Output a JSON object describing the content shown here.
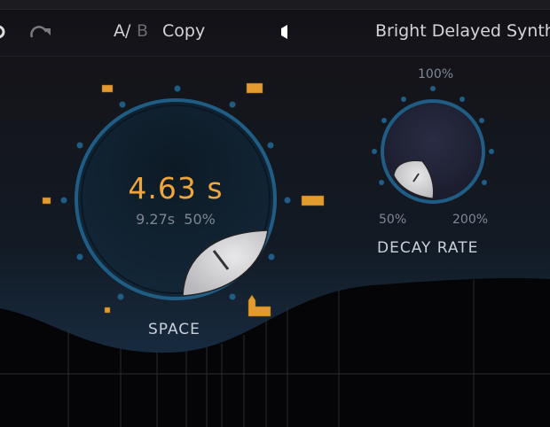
{
  "toolbar": {
    "a_label": "A/",
    "b_label": "B",
    "copy_label": "Copy",
    "preset_name": "Bright Delayed Synth",
    "undo_icon": "undo-icon",
    "redo_icon": "redo-icon",
    "prev_icon": "triangle-left-icon"
  },
  "space": {
    "label": "SPACE",
    "value": "4.63 s",
    "secondary": "9.27s  50%"
  },
  "decay": {
    "label": "DECAY RATE",
    "min": "50%",
    "mid": "100%",
    "max": "200%"
  },
  "colors": {
    "accent": "#f0a63a",
    "ring": "#1f5d85",
    "bg": "#0e0d12"
  }
}
